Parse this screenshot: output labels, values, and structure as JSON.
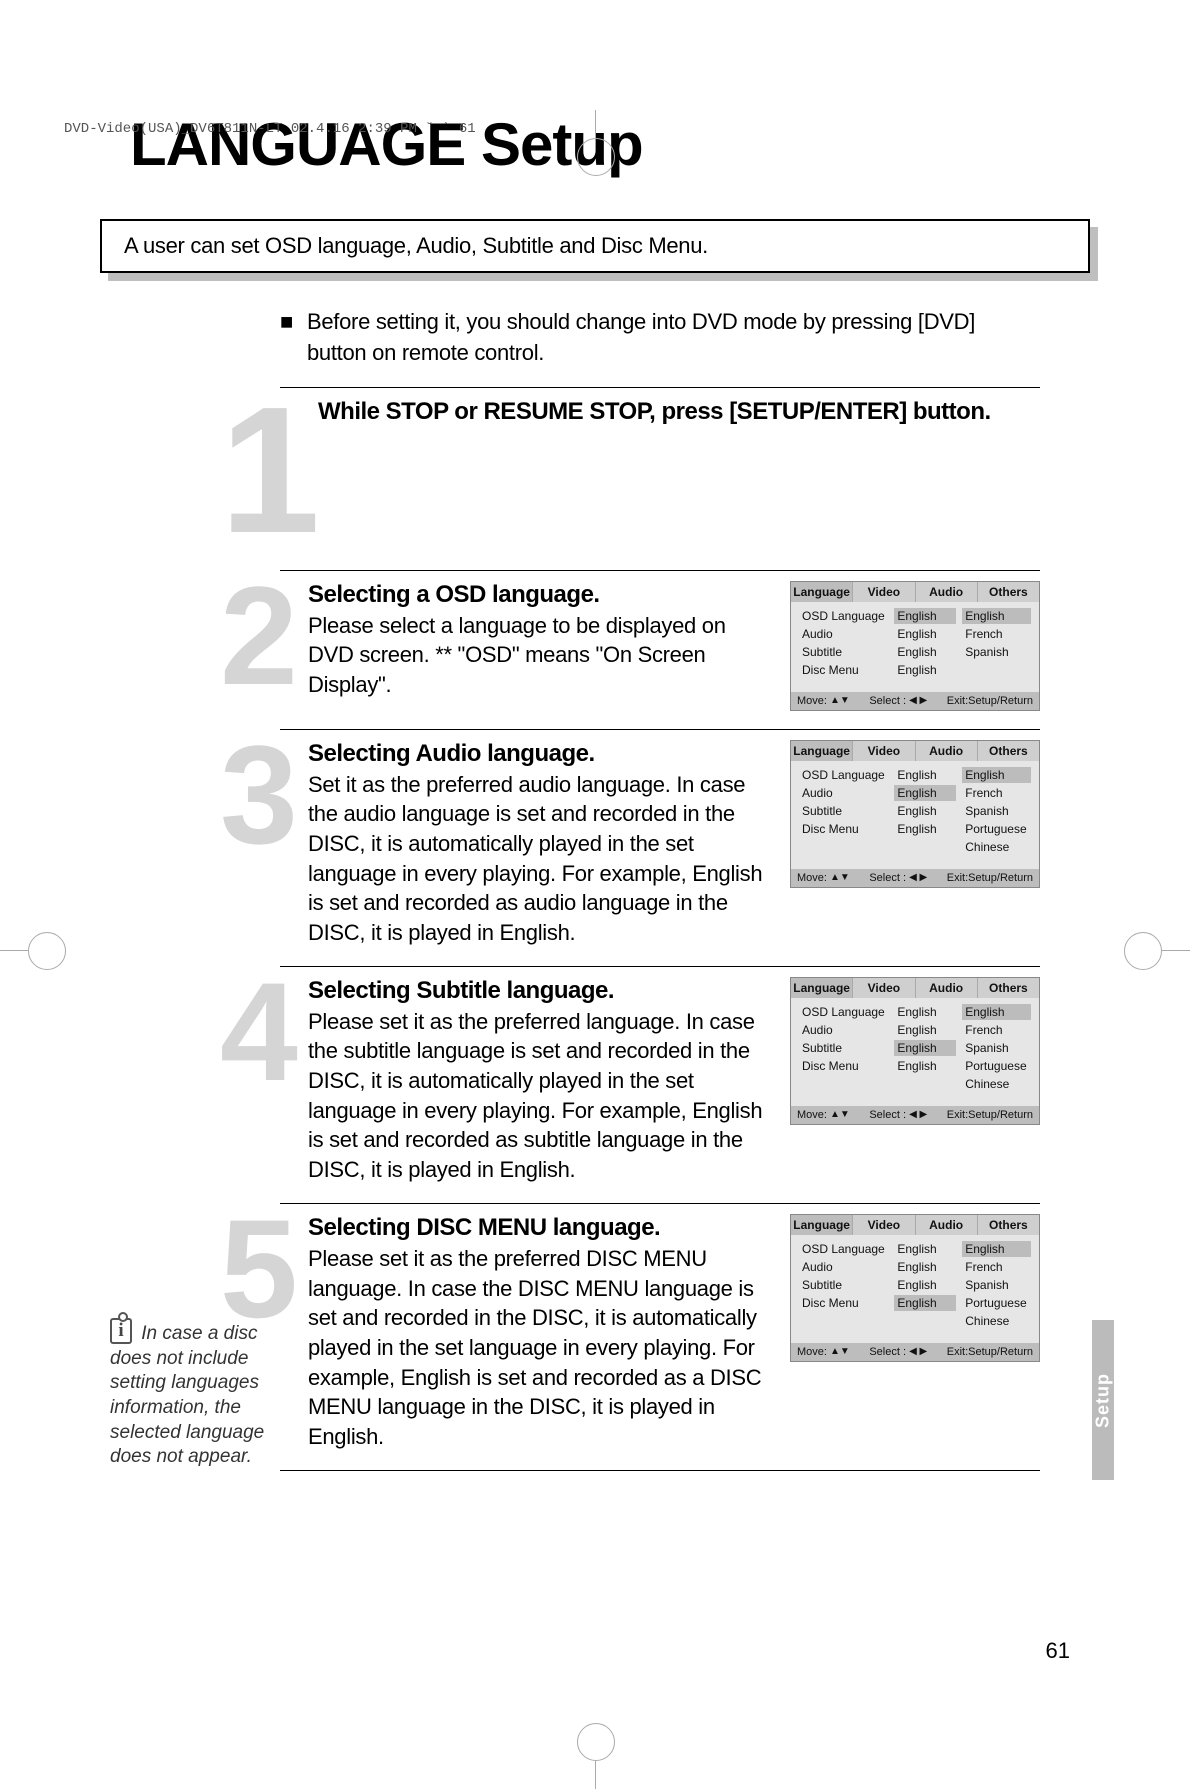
{
  "print_header": "DVD-Video(USA)_DV6T811N-LT  02.4.16 2:39 PM  ˘  `  61",
  "title_main": "LANGUAGE",
  "title_sub": "Setup",
  "intro": "A user can set OSD language, Audio, Subtitle and Disc Menu.",
  "pre_note_bullet": "■",
  "pre_note": "Before setting it, you should change into DVD mode by pressing [DVD] button on remote control.",
  "steps": [
    {
      "num": "1",
      "heading": "While STOP or RESUME STOP, press [SETUP/ENTER] button."
    },
    {
      "num": "2",
      "sub": "Selecting a OSD language.",
      "text": "Please select a language to be displayed on DVD screen.\n** \"OSD\" means \"On Screen Display\".",
      "osd": {
        "tabs": [
          "Language",
          "Video",
          "Audio",
          "Others"
        ],
        "active_tab": 0,
        "rows": [
          "OSD Language",
          "Audio",
          "Subtitle",
          "Disc Menu"
        ],
        "vals": [
          "English",
          "English",
          "English",
          "English"
        ],
        "val_highlight": 0,
        "opts": [
          "English",
          "French",
          "Spanish"
        ],
        "foot_move": "Move:",
        "foot_select": "Select :",
        "foot_exit": "Exit:Setup/Return"
      }
    },
    {
      "num": "3",
      "sub": "Selecting Audio language.",
      "text": "Set it as the preferred audio language. In case the audio language is set and recorded in the DISC, it is automatically played in the set language in every playing. For example, English is set and recorded as audio language in the DISC, it is played in English.",
      "osd": {
        "tabs": [
          "Language",
          "Video",
          "Audio",
          "Others"
        ],
        "active_tab": 0,
        "rows": [
          "OSD Language",
          "Audio",
          "Subtitle",
          "Disc Menu"
        ],
        "vals": [
          "English",
          "English",
          "English",
          "English"
        ],
        "val_highlight": 1,
        "opts": [
          "English",
          "French",
          "Spanish",
          "Portuguese",
          "Chinese"
        ],
        "foot_move": "Move:",
        "foot_select": "Select :",
        "foot_exit": "Exit:Setup/Return"
      }
    },
    {
      "num": "4",
      "sub": "Selecting Subtitle language.",
      "text": "Please set it as the preferred language. In case the subtitle language is set and recorded in the DISC, it is automatically played in the set language in every playing. For example, English is set and recorded as subtitle language in the DISC, it is played in English.",
      "osd": {
        "tabs": [
          "Language",
          "Video",
          "Audio",
          "Others"
        ],
        "active_tab": 0,
        "rows": [
          "OSD Language",
          "Audio",
          "Subtitle",
          "Disc Menu"
        ],
        "vals": [
          "English",
          "English",
          "English",
          "English"
        ],
        "val_highlight": 2,
        "opts": [
          "English",
          "French",
          "Spanish",
          "Portuguese",
          "Chinese"
        ],
        "foot_move": "Move:",
        "foot_select": "Select :",
        "foot_exit": "Exit:Setup/Return"
      }
    },
    {
      "num": "5",
      "sub": "Selecting DISC MENU language.",
      "text": "Please set it as the preferred DISC MENU language. In case the DISC MENU language is set and recorded in the DISC, it is automatically played in the set language in every playing. For example, English is set and recorded as a DISC MENU language in the DISC, it is played in English.",
      "osd": {
        "tabs": [
          "Language",
          "Video",
          "Audio",
          "Others"
        ],
        "active_tab": 0,
        "rows": [
          "OSD Language",
          "Audio",
          "Subtitle",
          "Disc Menu"
        ],
        "vals": [
          "English",
          "English",
          "English",
          "English"
        ],
        "val_highlight": 3,
        "opts": [
          "English",
          "French",
          "Spanish",
          "Portuguese",
          "Chinese"
        ],
        "foot_move": "Move:",
        "foot_select": "Select :",
        "foot_exit": "Exit:Setup/Return"
      }
    }
  ],
  "side_note_icon": "i",
  "side_note": "In case a disc does not include setting languages information, the selected language does not appear.",
  "side_tab": "Setup",
  "page_number": "61"
}
